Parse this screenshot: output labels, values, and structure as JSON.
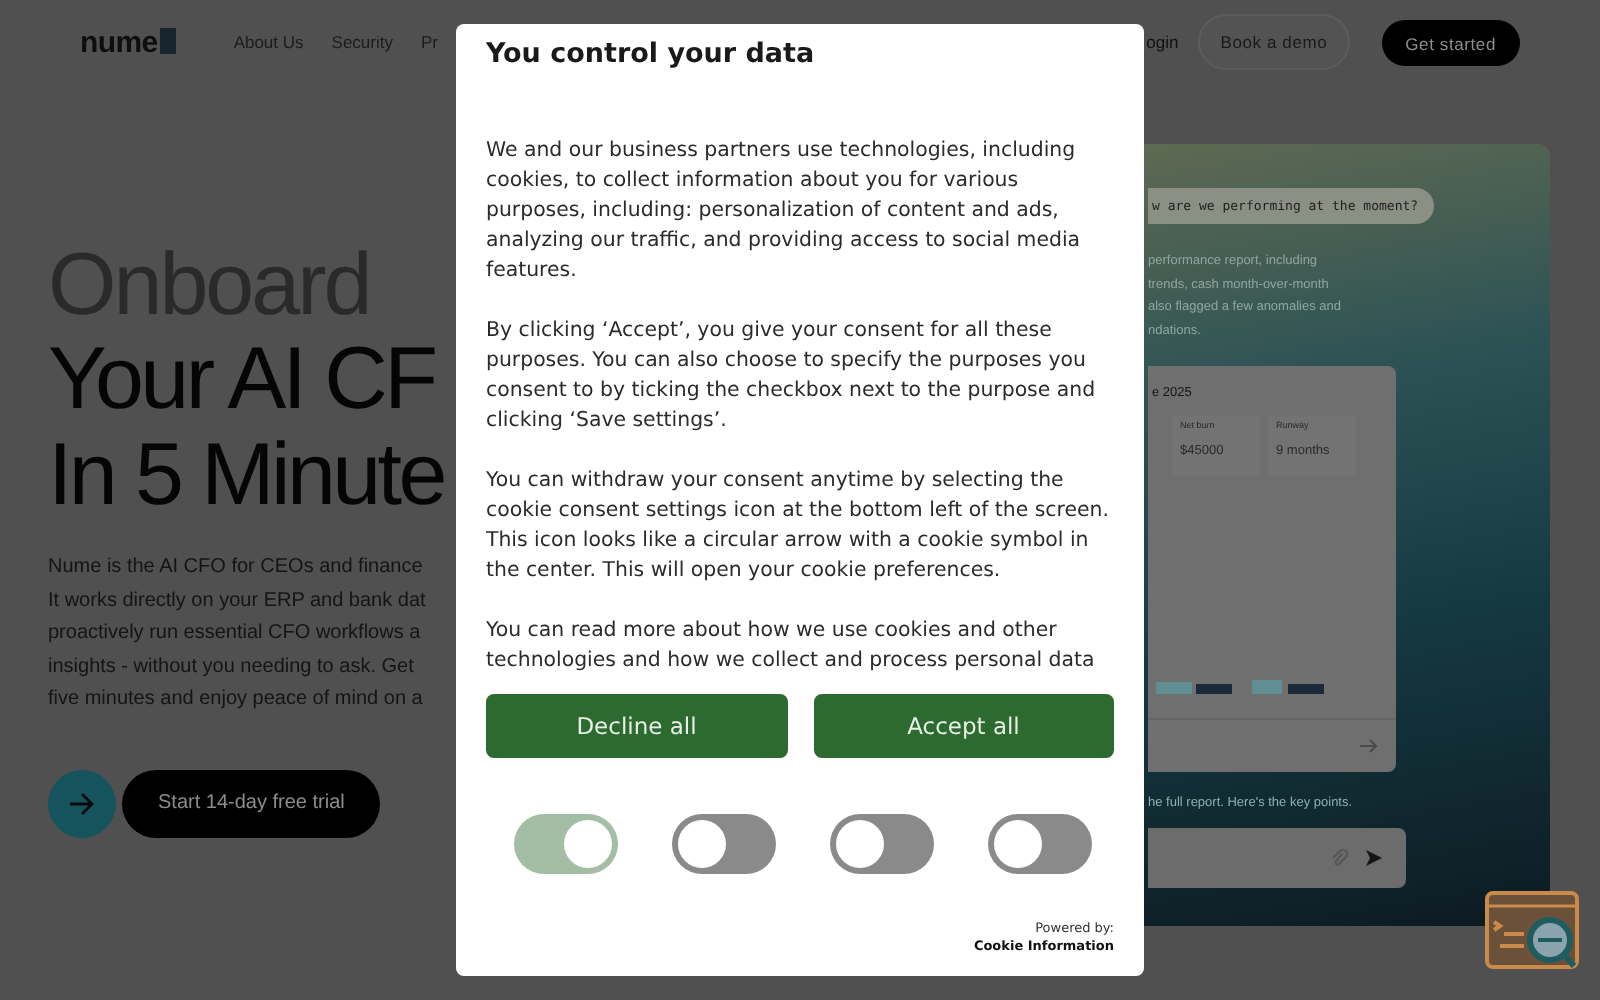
{
  "header": {
    "logo": "nume",
    "nav": [
      "About Us",
      "Security",
      "Pr"
    ],
    "login": "ogin",
    "demo_button": "Book a demo",
    "cta_button": "Get started"
  },
  "hero": {
    "eyebrow": "Onboard",
    "headline_lines": [
      "Your AI CF",
      "In 5 Minute"
    ],
    "description_lines": [
      "Nume is the AI CFO for CEOs and finance",
      "It works directly on your ERP and bank dat",
      "proactively run essential CFO workflows a",
      "insights - without you needing to ask. Get",
      "five minutes and enjoy peace of mind on a"
    ],
    "trial_button": "Start 14-day free trial"
  },
  "chat_preview": {
    "question": "w are we performing at the moment?",
    "answer_lines": [
      "performance report, including",
      "trends, cash month-over-month",
      "also flagged a few anomalies and",
      "ndations."
    ],
    "card_title": "e 2025",
    "stats": [
      {
        "label": "Net burn",
        "value": "$45000"
      },
      {
        "label": "Runway",
        "value": "9 months"
      }
    ],
    "summary": "he full report. Here's the key points."
  },
  "cookie_dialog": {
    "title": "You control your data",
    "paragraphs": [
      "We and our business partners use technologies, including cookies, to collect information about you for various purposes, including: personalization of content and ads, analyzing our traffic, and providing access to social media features.",
      "By clicking ‘Accept’, you give your consent for all these purposes. You can also choose to specify the purposes you consent to by ticking the checkbox next to the purpose and clicking ‘Save settings’.",
      "You can withdraw your consent anytime by selecting the cookie consent settings icon at the bottom left of the screen. This icon looks like a circular arrow with a cookie symbol in the center. This will open your cookie preferences.",
      "You can read more about how we use cookies and other technologies and how we collect and process personal data"
    ],
    "decline_button": "Decline all",
    "accept_button": "Accept all",
    "toggles": [
      {
        "on": true
      },
      {
        "on": false
      },
      {
        "on": false
      },
      {
        "on": false
      }
    ],
    "powered_by": "Powered by:",
    "provider": "Cookie Information"
  }
}
